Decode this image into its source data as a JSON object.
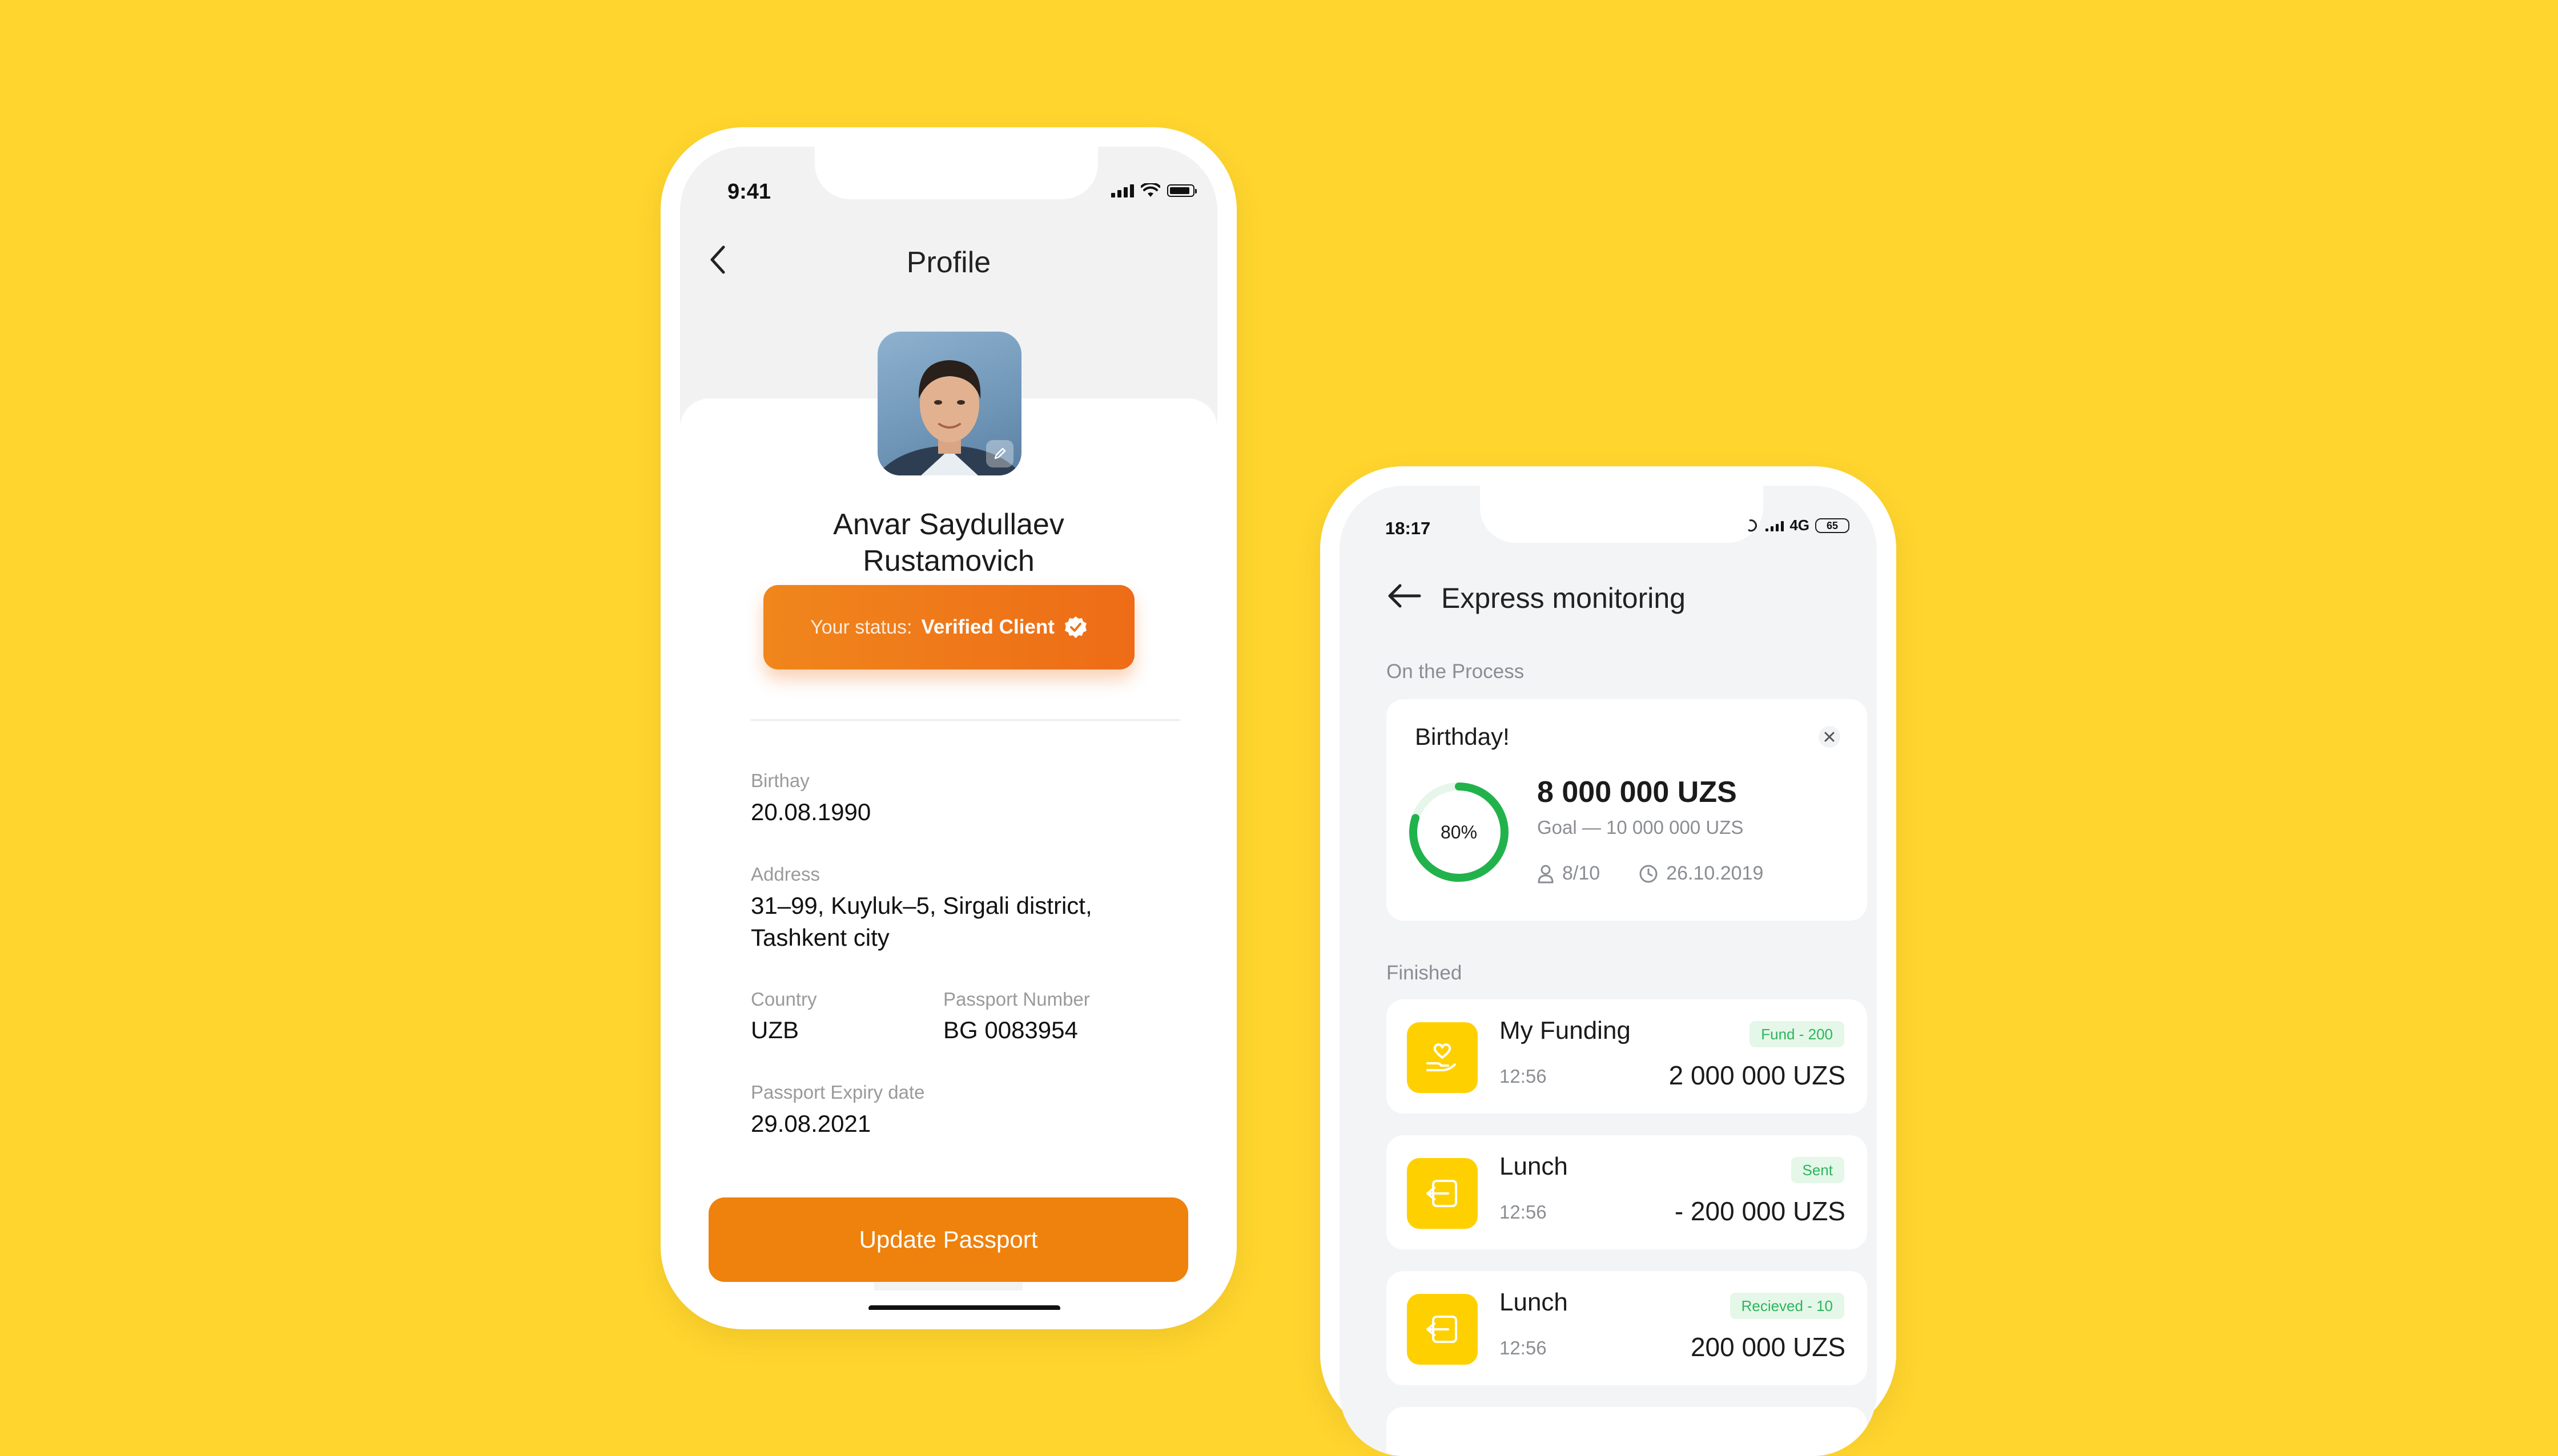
{
  "colors": {
    "background": "#FFD52E",
    "accent_orange": "#EE820D",
    "status_gradient_start": "#F0861C",
    "status_gradient_end": "#EE6C17",
    "progress_green": "#22B24C",
    "badge_green": "#2DB55D",
    "icon_yellow": "#FFD000"
  },
  "profile_screen": {
    "status_bar": {
      "time": "9:41"
    },
    "header": {
      "title": "Profile",
      "back_icon": "chevron-left-icon"
    },
    "user": {
      "name_line1": "Anvar Saydullaev",
      "name_line2": "Rustamovich"
    },
    "status": {
      "label": "Your status:",
      "value": "Verified Client",
      "icon": "verified-badge-icon"
    },
    "fields": {
      "birthday": {
        "label": "Birthay",
        "value": "20.08.1990"
      },
      "address": {
        "label": "Address",
        "value_line1": "31–99, Kuyluk–5, Sirgali district,",
        "value_line2": "Tashkent city"
      },
      "country": {
        "label": "Country",
        "value": "UZB"
      },
      "passport_number": {
        "label": "Passport Number",
        "value": "BG 0083954"
      },
      "passport_expiry": {
        "label": "Passport Expiry date",
        "value": "29.08.2021"
      }
    },
    "update_button": {
      "label": "Update Passport"
    }
  },
  "monitoring_screen": {
    "status_bar": {
      "time": "18:17",
      "network": "4G",
      "battery": "65"
    },
    "header": {
      "title": "Express monitoring",
      "back_icon": "arrow-left-icon"
    },
    "sections": {
      "in_process": "On the Process",
      "finished": "Finished"
    },
    "birthday_card": {
      "title": "Birthday!",
      "progress_percent": 80,
      "progress_label": "80%",
      "amount": "8 000 000 UZS",
      "goal": "Goal —  10 000 000 UZS",
      "participants": "8/10",
      "date": "26.10.2019"
    },
    "transactions": [
      {
        "title": "My Funding",
        "time": "12:56",
        "badge": "Fund - 200",
        "amount": "2 000 000 UZS",
        "icon": "hand-heart-icon"
      },
      {
        "title": "Lunch",
        "time": "12:56",
        "badge": "Sent",
        "amount": "- 200 000 UZS",
        "icon": "transfer-icon"
      },
      {
        "title": "Lunch",
        "time": "12:56",
        "badge": "Recieved - 10",
        "amount": "200 000 UZS",
        "icon": "transfer-icon"
      }
    ]
  }
}
